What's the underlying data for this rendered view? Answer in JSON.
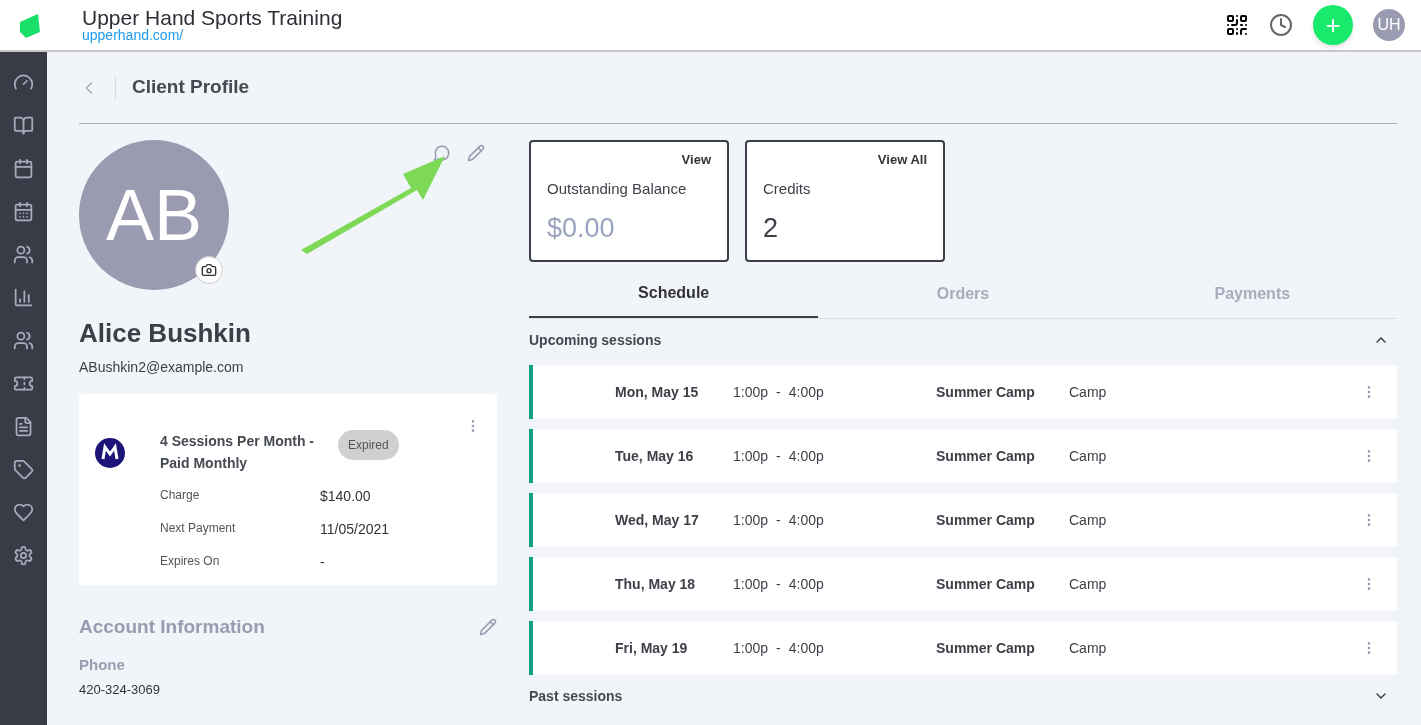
{
  "header": {
    "title": "Upper Hand Sports Training",
    "url": "upperhand.com/",
    "avatar": "UH",
    "add_button": "+"
  },
  "sidebar": {
    "items": [
      {
        "selected": false
      },
      {
        "selected": false
      },
      {
        "selected": false
      },
      {
        "selected": false
      },
      {
        "selected": false
      },
      {
        "selected": false
      },
      {
        "selected": false
      },
      {
        "selected": false
      },
      {
        "selected": false
      },
      {
        "selected": false
      },
      {
        "selected": false
      },
      {
        "selected": false
      }
    ]
  },
  "page": {
    "title": "Client Profile"
  },
  "client": {
    "initials": "AB",
    "name": "Alice Bushkin",
    "email": "ABushkin2@example.com"
  },
  "membership": {
    "name": "4 Sessions Per Month - Paid Monthly",
    "status": "Expired",
    "fields": [
      {
        "label": "Charge",
        "value": "$140.00"
      },
      {
        "label": "Next Payment",
        "value": "11/05/2021"
      },
      {
        "label": "Expires On",
        "value": "-"
      }
    ]
  },
  "account": {
    "title": "Account Information",
    "fields": [
      {
        "label": "Phone",
        "value": "420-324-3069"
      }
    ]
  },
  "cards": [
    {
      "link": "View",
      "label": "Outstanding Balance",
      "value": "$0.00",
      "muted": true
    },
    {
      "link": "View All",
      "label": "Credits",
      "value": "2",
      "muted": false
    }
  ],
  "tabs": [
    {
      "label": "Schedule",
      "selected": true
    },
    {
      "label": "Orders",
      "selected": false
    },
    {
      "label": "Payments",
      "selected": false
    }
  ],
  "sections": [
    {
      "title": "Upcoming sessions",
      "expanded": true,
      "sessions": [
        {
          "date": "Mon, May 15",
          "start": "1:00p",
          "separator": "-",
          "end": "4:00p",
          "event": "Summer Camp",
          "type": "Camp"
        },
        {
          "date": "Tue, May 16",
          "start": "1:00p",
          "separator": "-",
          "end": "4:00p",
          "event": "Summer Camp",
          "type": "Camp"
        },
        {
          "date": "Wed, May 17",
          "start": "1:00p",
          "separator": "-",
          "end": "4:00p",
          "event": "Summer Camp",
          "type": "Camp"
        },
        {
          "date": "Thu, May 18",
          "start": "1:00p",
          "separator": "-",
          "end": "4:00p",
          "event": "Summer Camp",
          "type": "Camp"
        },
        {
          "date": "Fri, May 19",
          "start": "1:00p",
          "separator": "-",
          "end": "4:00p",
          "event": "Summer Camp",
          "type": "Camp"
        }
      ]
    },
    {
      "title": "Past sessions",
      "expanded": false
    }
  ]
}
